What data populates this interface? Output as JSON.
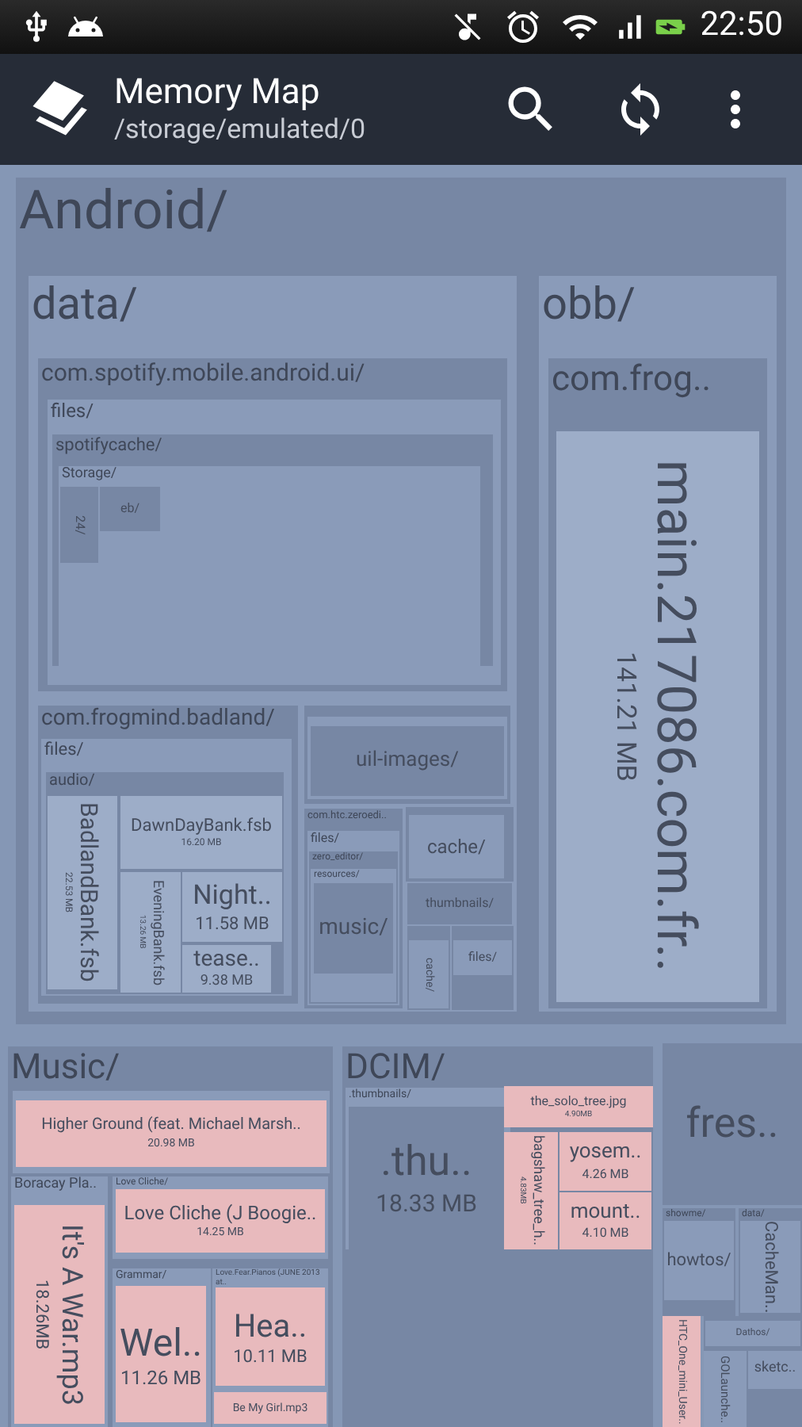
{
  "status_bar": {
    "time": "22:50"
  },
  "app_bar": {
    "title": "Memory Map",
    "subtitle": "/storage/emulated/0"
  },
  "treemap": {
    "nodes": [
      {
        "name": "Android/",
        "kind": "folder",
        "children": [
          {
            "name": "data/",
            "kind": "folder",
            "children": [
              {
                "name": "com.spotify.mobile.android.ui/",
                "kind": "folder",
                "children": [
                  {
                    "name": "files/",
                    "kind": "folder",
                    "children": [
                      {
                        "name": "spotifycache/",
                        "kind": "folder",
                        "children": [
                          {
                            "name": "Storage/",
                            "kind": "folder",
                            "children": [
                              {
                                "name": "24/",
                                "kind": "folder",
                                "vertical": true
                              },
                              {
                                "name": "eb/",
                                "kind": "folder"
                              }
                            ]
                          }
                        ]
                      }
                    ]
                  }
                ]
              },
              {
                "name": "com.frogmind.badland/",
                "kind": "folder",
                "children": [
                  {
                    "name": "files/",
                    "kind": "folder",
                    "children": [
                      {
                        "name": "audio/",
                        "kind": "folder",
                        "children": [
                          {
                            "name": "BadlandBank.fsb",
                            "size": "22.53 MB",
                            "kind": "file",
                            "vertical": true
                          },
                          {
                            "name": "DawnDayBank.fsb",
                            "size": "16.20 MB",
                            "kind": "file"
                          },
                          {
                            "name": "EveningBank.fsb",
                            "size": "13.26 MB",
                            "kind": "file",
                            "vertical": true
                          },
                          {
                            "name": "Night..",
                            "size": "11.58 MB",
                            "kind": "file"
                          },
                          {
                            "name": "tease..",
                            "size": "9.38 MB",
                            "kind": "file"
                          }
                        ]
                      }
                    ]
                  }
                ]
              },
              {
                "kind": "folder",
                "children": [
                  {
                    "kind": "folder",
                    "children": [
                      {
                        "name": "uil-images/",
                        "kind": "folder"
                      }
                    ]
                  }
                ]
              },
              {
                "name": "com.htc.zeroedi..",
                "kind": "folder",
                "children": [
                  {
                    "name": "files/",
                    "kind": "folder",
                    "children": [
                      {
                        "name": "zero_editor/",
                        "kind": "folder",
                        "children": [
                          {
                            "name": "resources/",
                            "kind": "folder",
                            "children": [
                              {
                                "name": "music/",
                                "kind": "folder"
                              }
                            ]
                          }
                        ]
                      }
                    ]
                  }
                ]
              },
              {
                "kind": "folder",
                "children": [
                  {
                    "name": "cache/",
                    "kind": "folder"
                  }
                ]
              },
              {
                "name": "thumbnails/",
                "kind": "folder"
              },
              {
                "kind": "folder",
                "children": [
                  {
                    "name": "cache/",
                    "kind": "folder",
                    "vertical": true
                  }
                ]
              },
              {
                "kind": "folder",
                "children": [
                  {
                    "name": "files/",
                    "kind": "folder"
                  }
                ]
              }
            ]
          },
          {
            "name": "obb/",
            "kind": "folder",
            "children": [
              {
                "name": "com.frog..",
                "kind": "folder",
                "children": [
                  {
                    "name": "main.217086.com.fr..",
                    "size": "141.21 MB",
                    "kind": "file",
                    "vertical": true
                  }
                ]
              }
            ]
          }
        ]
      },
      {
        "name": "Music/",
        "kind": "folder",
        "children": [
          {
            "kind": "folder",
            "children": [
              {
                "name": "Higher Ground (feat. Michael Marsh..",
                "size": "20.98 MB",
                "kind": "media"
              }
            ]
          },
          {
            "name": "Boracay Pla..",
            "kind": "folder",
            "children": [
              {
                "name": "It's A War.mp3",
                "size": "18.26MB",
                "kind": "media",
                "vertical": true
              }
            ]
          },
          {
            "name": "Love Cliche/",
            "kind": "folder",
            "children": [
              {
                "name": "Love Cliche (J Boogie..",
                "size": "14.25 MB",
                "kind": "media"
              }
            ]
          },
          {
            "name": "Grammar/",
            "kind": "folder",
            "children": [
              {
                "name": "Wel..",
                "size": "11.26 MB",
                "kind": "media"
              }
            ]
          },
          {
            "name": "Love.Fear.Pianos (JUNE 2013 at..",
            "kind": "folder",
            "children": [
              {
                "name": "Hea..",
                "size": "10.11 MB",
                "kind": "media"
              }
            ]
          },
          {
            "kind": "folder",
            "children": [
              {
                "name": "Be My Girl.mp3",
                "kind": "media"
              }
            ]
          }
        ]
      },
      {
        "name": "DCIM/",
        "kind": "folder",
        "children": [
          {
            "name": ".thumbnails/",
            "kind": "folder",
            "children": [
              {
                "name": ".thu..",
                "size": "18.33 MB",
                "kind": "folder"
              }
            ]
          },
          {
            "name": "the_solo_tree.jpg",
            "size": "4.90MB",
            "kind": "media"
          },
          {
            "name": "bagshaw_tree_h..",
            "size": "4.83MB",
            "kind": "media",
            "vertical": true
          },
          {
            "name": "yosem..",
            "size": "4.26 MB",
            "kind": "media"
          },
          {
            "name": "mount..",
            "size": "4.10 MB",
            "kind": "media"
          }
        ]
      },
      {
        "name": "fres..",
        "kind": "folder"
      },
      {
        "name": "showme/",
        "kind": "folder",
        "children": [
          {
            "name": "howtos/",
            "kind": "folder"
          }
        ]
      },
      {
        "name": "data/",
        "kind": "folder",
        "children": [
          {
            "name": "CacheMan..",
            "kind": "folder",
            "vertical": true
          }
        ]
      },
      {
        "name": "HTC_One_mini_User..",
        "kind": "media",
        "vertical": true
      },
      {
        "kind": "folder",
        "children": [
          {
            "name": "Dathos/",
            "kind": "folder"
          },
          {
            "name": "GOLaunche..",
            "kind": "folder",
            "vertical": true
          },
          {
            "name": "sketc..",
            "kind": "folder"
          }
        ]
      }
    ]
  }
}
